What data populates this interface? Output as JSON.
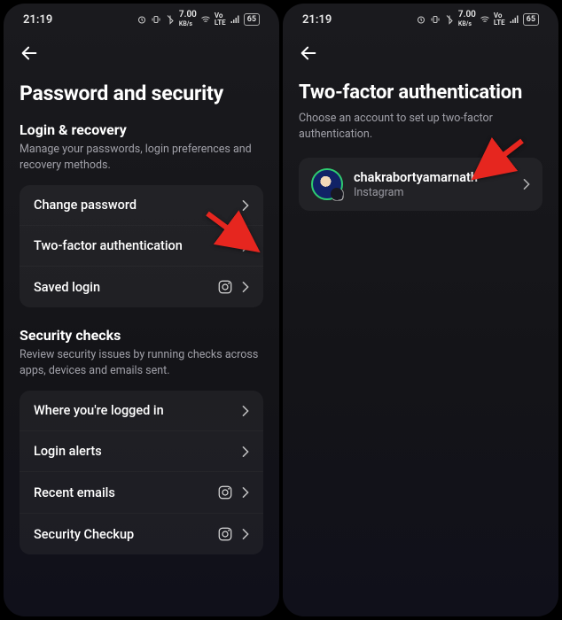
{
  "statusbar": {
    "time": "21:19",
    "kbps": "7.00",
    "kbps_unit": "KB/s",
    "battery": "65"
  },
  "left": {
    "title": "Password and security",
    "section1": {
      "heading": "Login & recovery",
      "sub": "Manage your passwords, login preferences and recovery methods.",
      "items": [
        {
          "label": "Change password"
        },
        {
          "label": "Two-factor authentication"
        },
        {
          "label": "Saved login"
        }
      ]
    },
    "section2": {
      "heading": "Security checks",
      "sub": "Review security issues by running checks across apps, devices and emails sent.",
      "items": [
        {
          "label": "Where you're logged in"
        },
        {
          "label": "Login alerts"
        },
        {
          "label": "Recent emails"
        },
        {
          "label": "Security Checkup"
        }
      ]
    }
  },
  "right": {
    "title": "Two-factor authentication",
    "sub": "Choose an account to set up two-factor authentication.",
    "account": {
      "name": "chakrabortyamarnath",
      "platform": "Instagram"
    }
  }
}
